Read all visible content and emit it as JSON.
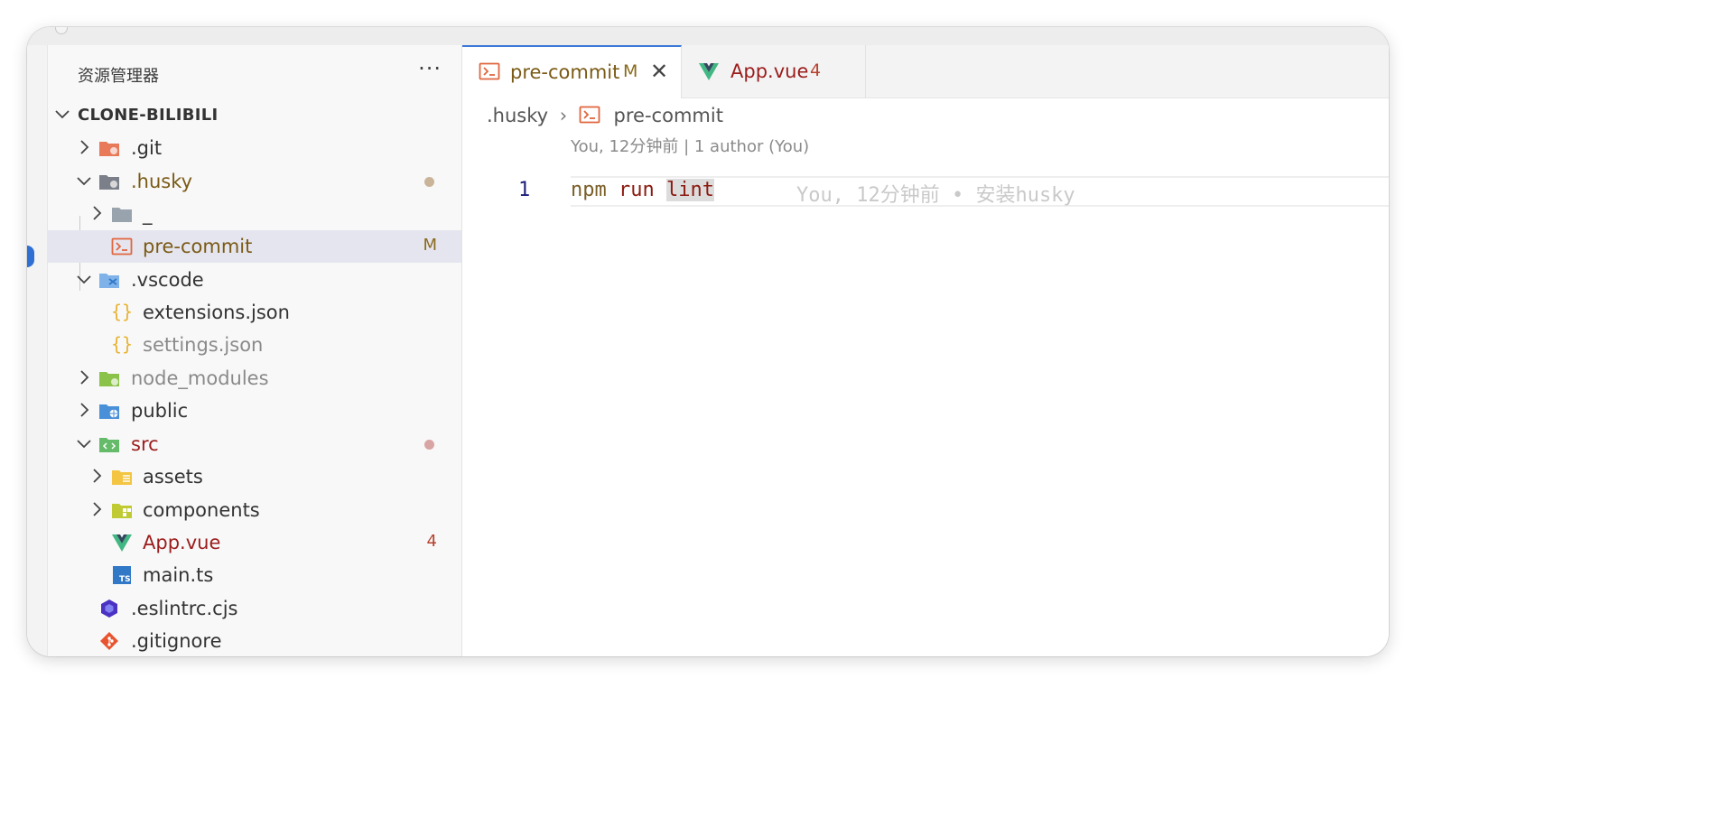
{
  "explorer": {
    "title": "资源管理器",
    "more_label": "···",
    "root_label": "CLONE-BILIBILI",
    "items": [
      {
        "label": ".git",
        "color": "#333333",
        "icon": "git-folder-icon",
        "chevron": "right"
      },
      {
        "label": ".husky",
        "color": "#7a5a15",
        "icon": "husky-folder-icon",
        "chevron": "down",
        "decoration": "modified-dot",
        "dot_color": "#c9b49a"
      },
      {
        "label": "_",
        "color": "#333333",
        "icon": "folder-icon",
        "chevron": "right"
      },
      {
        "label": "pre-commit",
        "color": "#7a5a15",
        "icon": "terminal-file-icon",
        "badge": "M",
        "badge_color": "#8a6a1e"
      },
      {
        "label": ".vscode",
        "color": "#333333",
        "icon": "vscode-folder-icon",
        "chevron": "down"
      },
      {
        "label": "extensions.json",
        "color": "#333333",
        "icon": "json-file-icon"
      },
      {
        "label": "settings.json",
        "color": "#8a8a8a",
        "icon": "json-file-icon"
      },
      {
        "label": "node_modules",
        "color": "#8a8a8a",
        "icon": "node-folder-icon",
        "chevron": "right"
      },
      {
        "label": "public",
        "color": "#333333",
        "icon": "public-folder-icon",
        "chevron": "right"
      },
      {
        "label": "src",
        "color": "#9b1c1c",
        "icon": "src-folder-icon",
        "chevron": "down",
        "decoration": "error-dot",
        "dot_color": "#d9a4a4"
      },
      {
        "label": "assets",
        "color": "#333333",
        "icon": "assets-folder-icon",
        "chevron": "right"
      },
      {
        "label": "components",
        "color": "#333333",
        "icon": "components-folder-icon",
        "chevron": "right"
      },
      {
        "label": "App.vue",
        "color": "#9b1c1c",
        "icon": "vue-file-icon",
        "badge": "4",
        "badge_color": "#b5432e"
      },
      {
        "label": "main.ts",
        "color": "#333333",
        "icon": "typescript-file-icon"
      },
      {
        "label": ".eslintrc.cjs",
        "color": "#333333",
        "icon": "eslint-file-icon"
      },
      {
        "label": ".gitignore",
        "color": "#333333",
        "icon": "git-file-icon"
      }
    ]
  },
  "tabs": [
    {
      "label": "pre-commit",
      "badge": "M",
      "close": "✕",
      "active": true,
      "color": "#7a5a15"
    },
    {
      "label": "App.vue",
      "badge": "4",
      "active": false,
      "color": "#9b1c1c"
    }
  ],
  "breadcrumb": {
    "folder": ".husky",
    "separator": "›",
    "file": "pre-commit"
  },
  "editor": {
    "blame_header": "You, 12分钟前 | 1 author (You)",
    "line_number": "1",
    "code_cmd": "npm",
    "code_arg": "run",
    "code_highlight": "lint",
    "inline_blame": "You, 12分钟前 • 安装husky"
  },
  "colors": {
    "accent": "#3a79d9",
    "selection": "#e5e5ef",
    "modified": "#8a6a1e",
    "error": "#9b1c1c"
  }
}
